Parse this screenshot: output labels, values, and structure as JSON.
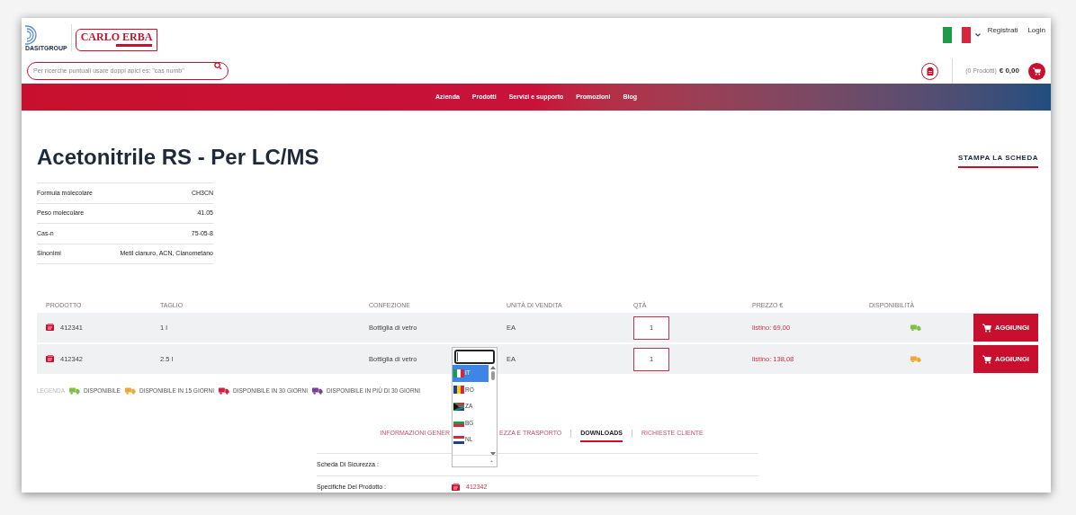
{
  "header": {
    "group_logo": "DASITGROUP",
    "brand_logo": "CARLO ERBA",
    "search": {
      "placeholder": "Per ricerche puntuali usare doppi apici es: \"cas numb\""
    },
    "account_links": [
      "Registrati",
      "Login"
    ],
    "cart": {
      "count": "(0 Prodotti)",
      "total": "€ 0,00"
    }
  },
  "nav": [
    "Azienda",
    "Prodotti",
    "Servizi e supporto",
    "Promozioni",
    "Blog"
  ],
  "title": "Acetonitrile RS - Per LC/MS",
  "print_link": "STAMPA LA SCHEDA",
  "properties": [
    {
      "label": "Formula molecolare",
      "value": "CH3CN"
    },
    {
      "label": "Peso molecolare",
      "value": "41.05"
    },
    {
      "label": "Cas-n",
      "value": "75-05-8"
    },
    {
      "label": "Sinonimi",
      "value": "Metil cianuro, ACN, Cianometano"
    }
  ],
  "products": {
    "columns": [
      "PRODOTTO",
      "TAGLIO",
      "CONFEZIONE",
      "UNITÀ DI VENDITA",
      "QTÀ",
      "PREZZO €",
      "DISPONIBILITÀ"
    ],
    "rows": [
      {
        "code": "412341",
        "size": "1 l",
        "packaging": "Bottiglia di vetro",
        "unit": "EA",
        "qty": "1",
        "price": "listino: 69,00",
        "color": "#7cc142",
        "button": "AGGIUNGI"
      },
      {
        "code": "412342",
        "size": "2.5 l",
        "packaging": "Bottiglia di vetro",
        "unit": "EA",
        "qty": "1",
        "price": "listino: 138,08",
        "color": "#f0a630",
        "button": "AGGIUNGI"
      }
    ]
  },
  "legend": {
    "label": "LEGENDA",
    "items": [
      {
        "label": "DISPONIBILE",
        "color": "#7cc142"
      },
      {
        "label": "DISPONIBILE IN 15 GIORNI",
        "color": "#f0a630"
      },
      {
        "label": "DISPONIBILE IN 30 GIORNI",
        "color": "#d6203f"
      },
      {
        "label": "DISPONIBILE IN PIÙ DI 30 GIORNI",
        "color": "#7b3f98"
      }
    ]
  },
  "tabs": [
    {
      "label": "INFORMAZIONI GENER",
      "selected": false
    },
    {
      "label": "EZZA E TRASPORTO",
      "selected": false
    },
    {
      "label": "DOWNLOADS",
      "selected": true
    },
    {
      "label": "RICHIESTE CLIENTE",
      "selected": false
    }
  ],
  "downloads": [
    {
      "label": "Scheda Di Sicurezza :"
    },
    {
      "label": "Specifiche Del Prodotto :",
      "link": "412342"
    }
  ],
  "language_dropdown": {
    "options": [
      {
        "code": "IT",
        "selected": true
      },
      {
        "code": "RO",
        "selected": false
      },
      {
        "code": "ZA",
        "selected": false
      },
      {
        "code": "BG",
        "selected": false
      },
      {
        "code": "NL",
        "selected": false
      }
    ]
  }
}
